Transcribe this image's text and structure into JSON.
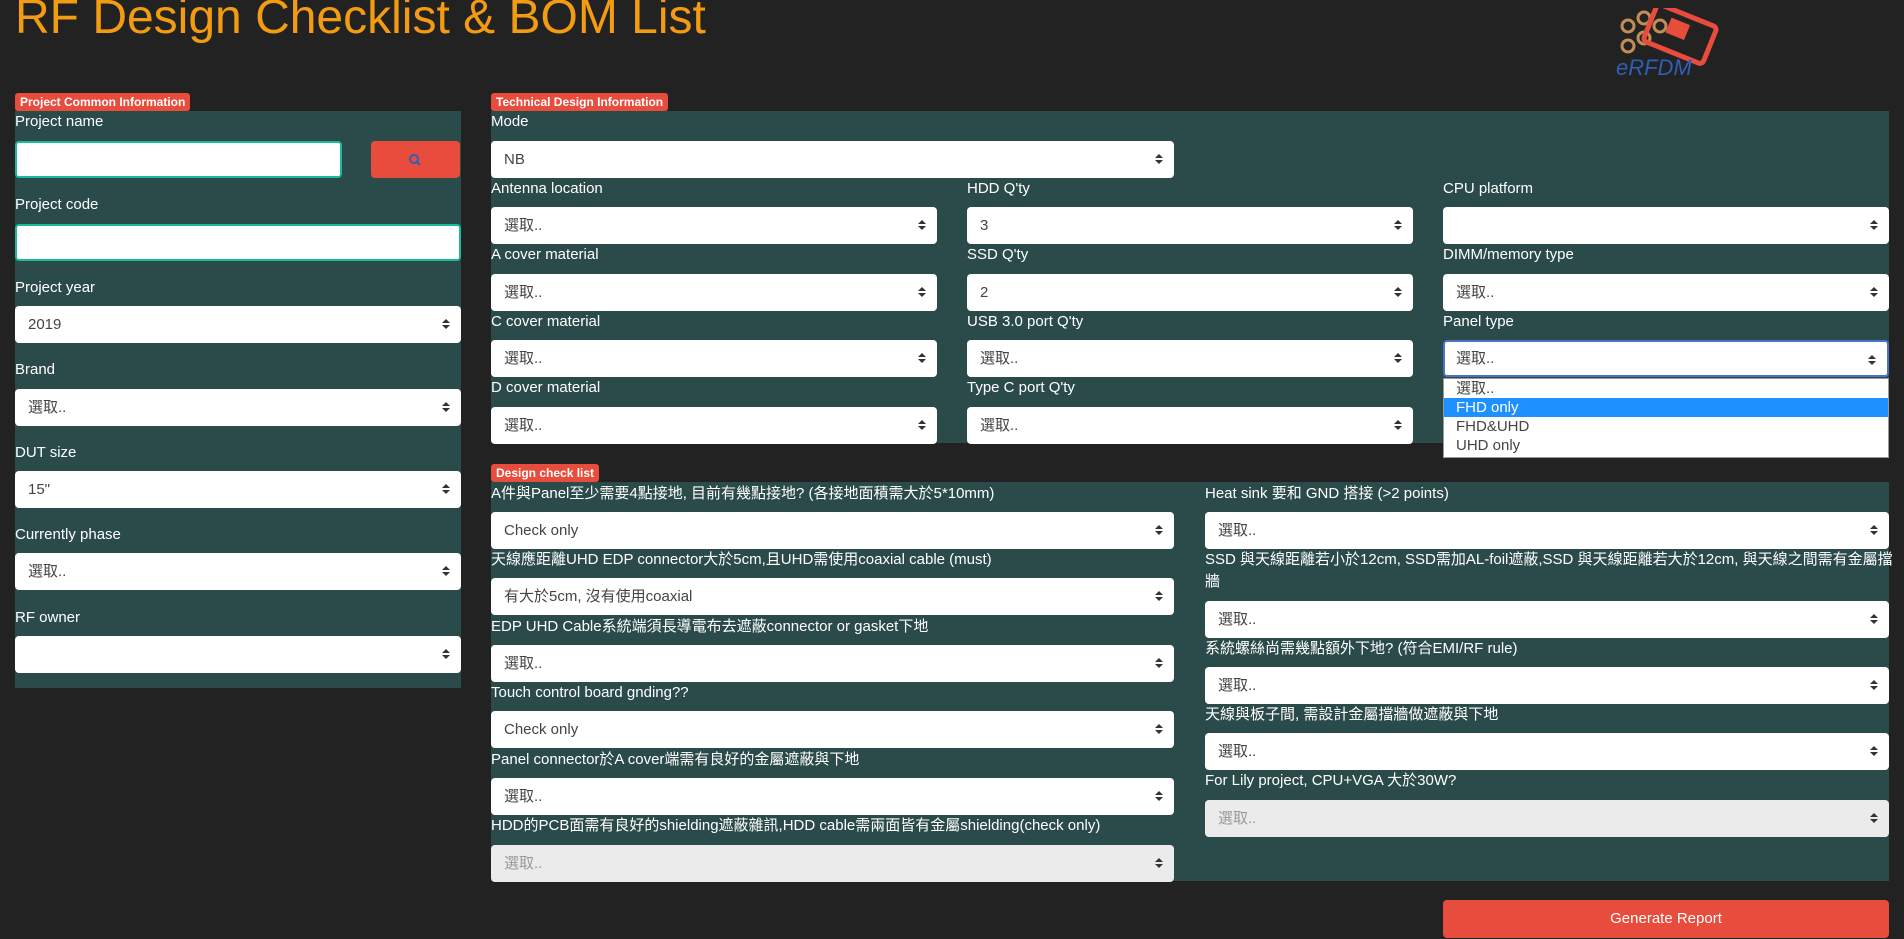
{
  "header": {
    "title": "RF Design Checklist & BOM List",
    "logo_text": "eRFDM"
  },
  "common": {
    "tag": "Project Common Information",
    "project_name_label": "Project name",
    "project_name_value": "",
    "project_code_label": "Project code",
    "project_code_value": "",
    "project_year_label": "Project year",
    "project_year_value": "2019",
    "brand_label": "Brand",
    "brand_value": "選取..",
    "dut_size_label": "DUT size",
    "dut_size_value": "15\"",
    "phase_label": "Currently phase",
    "phase_value": "選取..",
    "rf_owner_label": "RF owner",
    "rf_owner_value": ""
  },
  "technical": {
    "tag": "Technical Design Information",
    "mode_label": "Mode",
    "mode_value": "NB",
    "fields": [
      {
        "label": "Antenna location",
        "value": "選取.."
      },
      {
        "label": "HDD Q'ty",
        "value": "3"
      },
      {
        "label": "CPU platform",
        "value": ""
      },
      {
        "label": "A cover material",
        "value": "選取.."
      },
      {
        "label": "SSD Q'ty",
        "value": "2"
      },
      {
        "label": "DIMM/memory type",
        "value": "選取.."
      },
      {
        "label": "C cover material",
        "value": "選取.."
      },
      {
        "label": "USB 3.0 port Q'ty",
        "value": "選取.."
      },
      {
        "label": "Panel type",
        "value": "選取.."
      },
      {
        "label": "D cover material",
        "value": "選取.."
      },
      {
        "label": "Type C port Q'ty",
        "value": "選取.."
      }
    ],
    "panel_type_options": [
      "選取..",
      "FHD only",
      "FHD&UHD",
      "UHD only"
    ],
    "panel_type_highlighted": "FHD only"
  },
  "checklist": {
    "tag": "Design check list",
    "left": [
      {
        "label": "A件與Panel至少需要4點接地, 目前有幾點接地? (各接地面積需大於5*10mm)",
        "value": "Check only"
      },
      {
        "label": "天線應距離UHD EDP connector大於5cm,且UHD需使用coaxial cable (must)",
        "value": "有大於5cm, 沒有使用coaxial"
      },
      {
        "label": "EDP UHD Cable系統端須長導電布去遮蔽connector or gasket下地",
        "value": "選取.."
      },
      {
        "label": "Touch control board gnding??",
        "value": "Check only"
      },
      {
        "label": "Panel connector於A cover端需有良好的金屬遮蔽與下地",
        "value": "選取.."
      },
      {
        "label": "HDD的PCB面需有良好的shielding遮蔽雜訊,HDD cable需兩面皆有金屬shielding(check only)",
        "value": "選取.."
      }
    ],
    "right": [
      {
        "label": "Heat sink 要和 GND 搭接 (>2 points)",
        "value": "選取.."
      },
      {
        "label": "SSD 與天線距離若小於12cm, SSD需加AL-foil遮蔽,SSD 與天線距離若大於12cm, 與天線之間需有金屬擋",
        "label2": "牆",
        "value": "選取.."
      },
      {
        "label": "系統螺絲尚需幾點額外下地? (符合EMI/RF rule)",
        "value": "選取.."
      },
      {
        "label": "天線與板子間, 需設計金屬擋牆做遮蔽與下地",
        "value": "選取.."
      },
      {
        "label": "For Lily project, CPU+VGA 大於30W?",
        "value": "選取.."
      }
    ]
  },
  "actions": {
    "generate_label": "Generate Report"
  },
  "colors": {
    "accent": "#f39c12",
    "danger": "#e74c3c",
    "panel": "#2b4a4a",
    "focus": "#18bc9c"
  }
}
